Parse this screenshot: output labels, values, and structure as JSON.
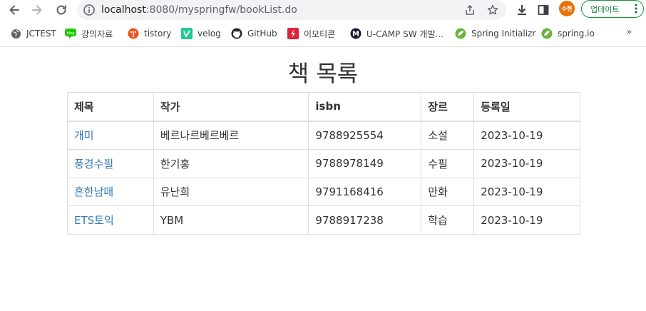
{
  "browser": {
    "url_host": "localhost",
    "url_path": ":8080/myspringfw/bookList.do",
    "profile_initials": "수현",
    "update_label": "업데이트",
    "bookmarks": [
      {
        "label": "JCTEST",
        "icon": "globe-icon"
      },
      {
        "label": "강의자료",
        "icon": "blog-icon"
      },
      {
        "label": "tistory",
        "icon": "tistory-icon"
      },
      {
        "label": "velog",
        "icon": "velog-icon"
      },
      {
        "label": "GitHub",
        "icon": "github-icon"
      },
      {
        "label": "이모티콘",
        "icon": "emoticon-icon"
      },
      {
        "label": "U-CAMP SW 개발...",
        "icon": "ucamp-icon"
      },
      {
        "label": "Spring Initializr",
        "icon": "spring-icon"
      },
      {
        "label": "spring.io",
        "icon": "spring-icon"
      }
    ],
    "colors": {
      "avatar": "#e8710a",
      "update_green": "#188038",
      "link": "#337ab7"
    }
  },
  "page": {
    "title": "책 목록",
    "table": {
      "headers": [
        "제목",
        "작가",
        "isbn",
        "장르",
        "등록일"
      ],
      "rows": [
        {
          "title": "개미",
          "author": "베르나르베르베르",
          "isbn": "9788925554",
          "genre": "소설",
          "date": "2023-10-19"
        },
        {
          "title": "풍경수필",
          "author": "한기홍",
          "isbn": "9788978149",
          "genre": "수필",
          "date": "2023-10-19"
        },
        {
          "title": "흔한남매",
          "author": "유난희",
          "isbn": "9791168416",
          "genre": "만화",
          "date": "2023-10-19"
        },
        {
          "title": "ETS토익",
          "author": "YBM",
          "isbn": "9788917238",
          "genre": "학습",
          "date": "2023-10-19"
        }
      ]
    }
  }
}
